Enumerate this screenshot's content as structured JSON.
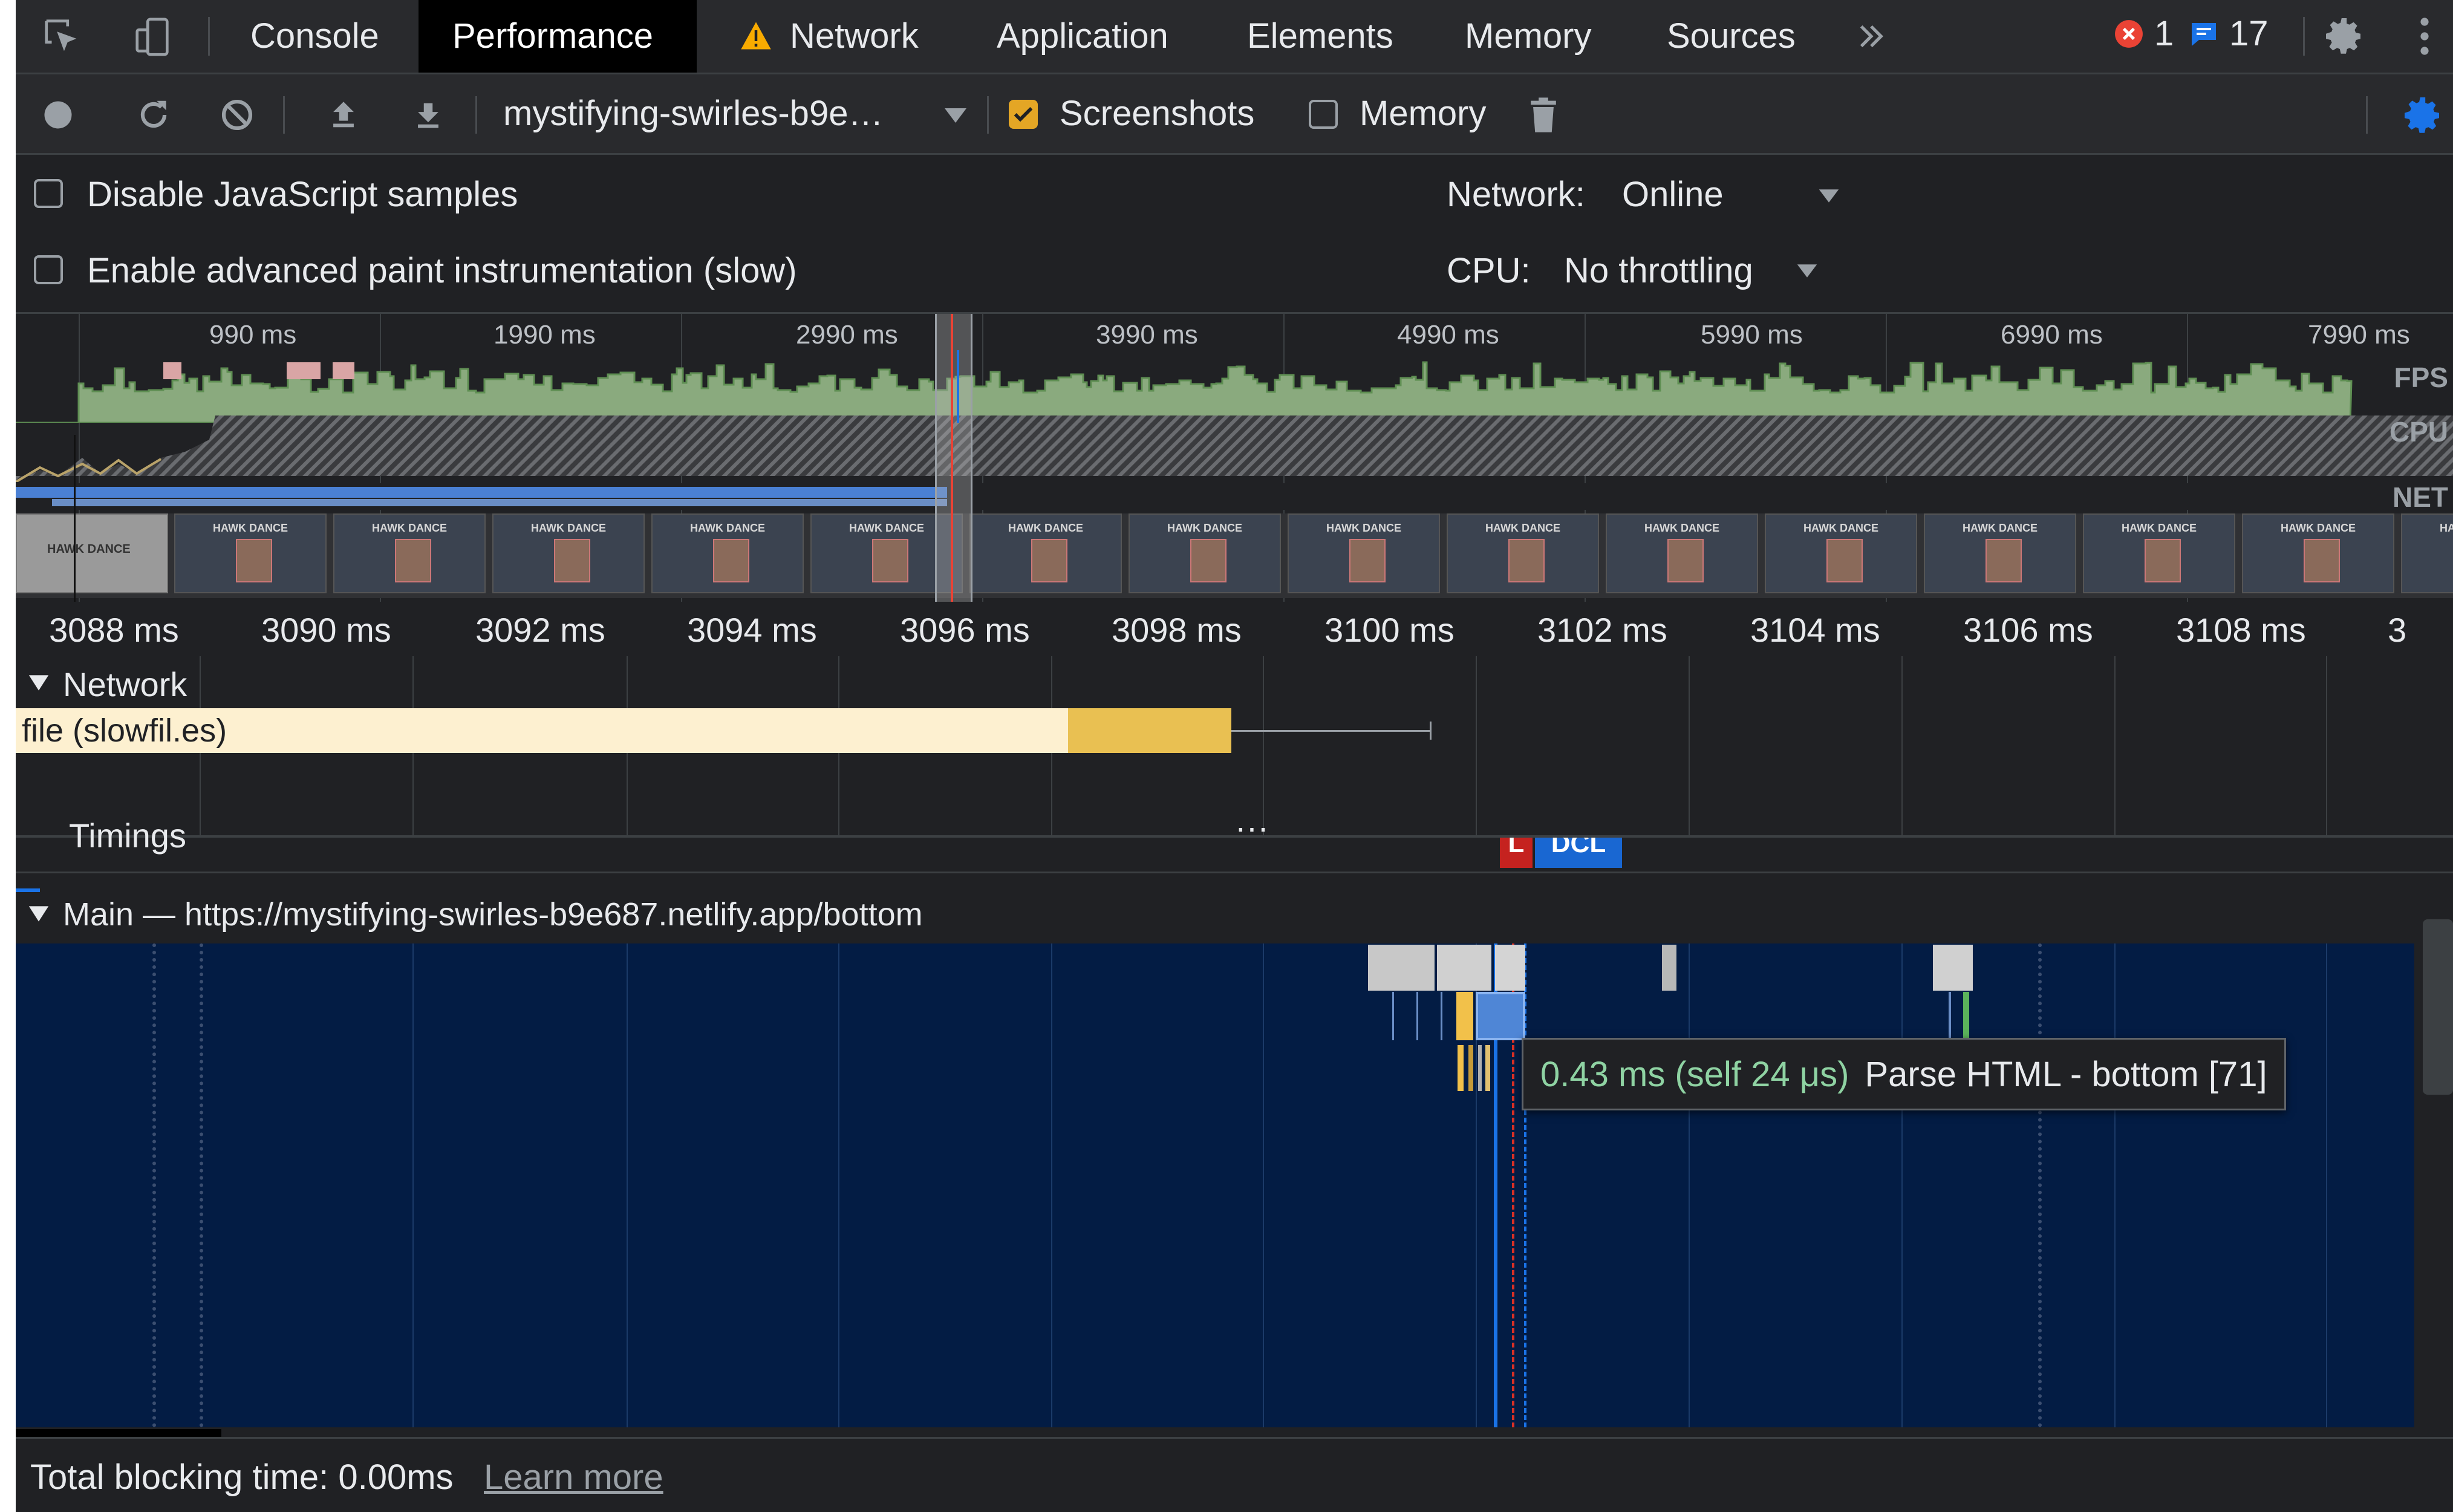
{
  "tabs": {
    "items": [
      {
        "label": "Console"
      },
      {
        "label": "Performance"
      },
      {
        "label": "Network"
      },
      {
        "label": "Application"
      },
      {
        "label": "Elements"
      },
      {
        "label": "Memory"
      },
      {
        "label": "Sources"
      }
    ],
    "more_icon": "double-chevron-right-icon",
    "errors_count": "1",
    "messages_count": "17",
    "error_color": "#ea4335",
    "message_color": "#1a73e8",
    "active_tab": "Performance"
  },
  "toolbar": {
    "profile_name": "mystifying-swirles-b9e…",
    "screenshots_label": "Screenshots",
    "screenshots_checked": true,
    "memory_label": "Memory",
    "memory_checked": false,
    "accent_color": "#e4a625",
    "gear_color": "#1a73e8"
  },
  "settings": {
    "disable_js_samples": "Disable JavaScript samples",
    "advanced_paint": "Enable advanced paint instrumentation (slow)",
    "network_label": "Network:",
    "network_value": "Online",
    "cpu_label": "CPU:",
    "cpu_value": "No throttling"
  },
  "overview": {
    "ticks": [
      "990 ms",
      "1990 ms",
      "2990 ms",
      "3990 ms",
      "4990 ms",
      "5990 ms",
      "6990 ms",
      "7990 ms"
    ],
    "fps_label": "FPS",
    "cpu_label": "CPU",
    "net_label": "NET",
    "screenshot_text": "HAWK DANCE"
  },
  "ruler": {
    "ticks": [
      "3088 ms",
      "3090 ms",
      "3092 ms",
      "3094 ms",
      "3096 ms",
      "3098 ms",
      "3100 ms",
      "3102 ms",
      "3104 ms",
      "3106 ms",
      "3108 ms",
      "3"
    ]
  },
  "network": {
    "header": "Network",
    "request_label": "file (slowfil.es)"
  },
  "timings": {
    "header": "Timings",
    "l_marker": "L",
    "dcl_marker": "DCL"
  },
  "main": {
    "header": "Main — https://mystifying-swirles-b9e687.netlify.app/bottom",
    "tooltip_time": "0.43 ms (self 24 μs)",
    "tooltip_label": "Parse HTML - bottom [71]"
  },
  "footer": {
    "tbt": "Total blocking time: 0.00ms",
    "learn_more": "Learn more"
  }
}
